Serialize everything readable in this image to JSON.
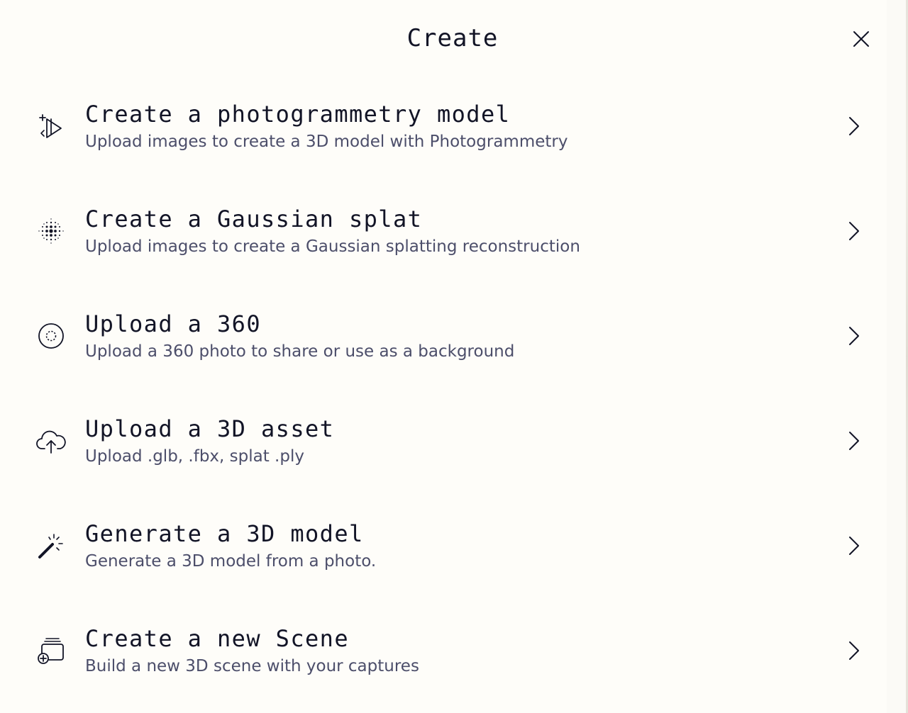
{
  "dialog": {
    "title": "Create",
    "close_icon": "close-icon"
  },
  "options": [
    {
      "title": "Create a photogrammetry model",
      "description": "Upload images to create a 3D model with Photogrammetry",
      "icon": "photogrammetry-icon"
    },
    {
      "title": "Create a Gaussian splat",
      "description": "Upload images to create a Gaussian splatting reconstruction",
      "icon": "gaussian-splat-icon"
    },
    {
      "title": "Upload a 360",
      "description": "Upload a 360 photo to share or use as a background",
      "icon": "panorama-360-icon"
    },
    {
      "title": "Upload a 3D asset",
      "description": "Upload .glb, .fbx, splat .ply",
      "icon": "cloud-upload-icon"
    },
    {
      "title": "Generate a 3D model",
      "description": "Generate a 3D model from a photo.",
      "icon": "magic-wand-icon"
    },
    {
      "title": "Create a new Scene",
      "description": "Build a new 3D scene with your captures",
      "icon": "new-scene-icon"
    }
  ],
  "colors": {
    "background": "#fefdf9",
    "title_text": "#121426",
    "description_text": "#4c4e6a"
  }
}
